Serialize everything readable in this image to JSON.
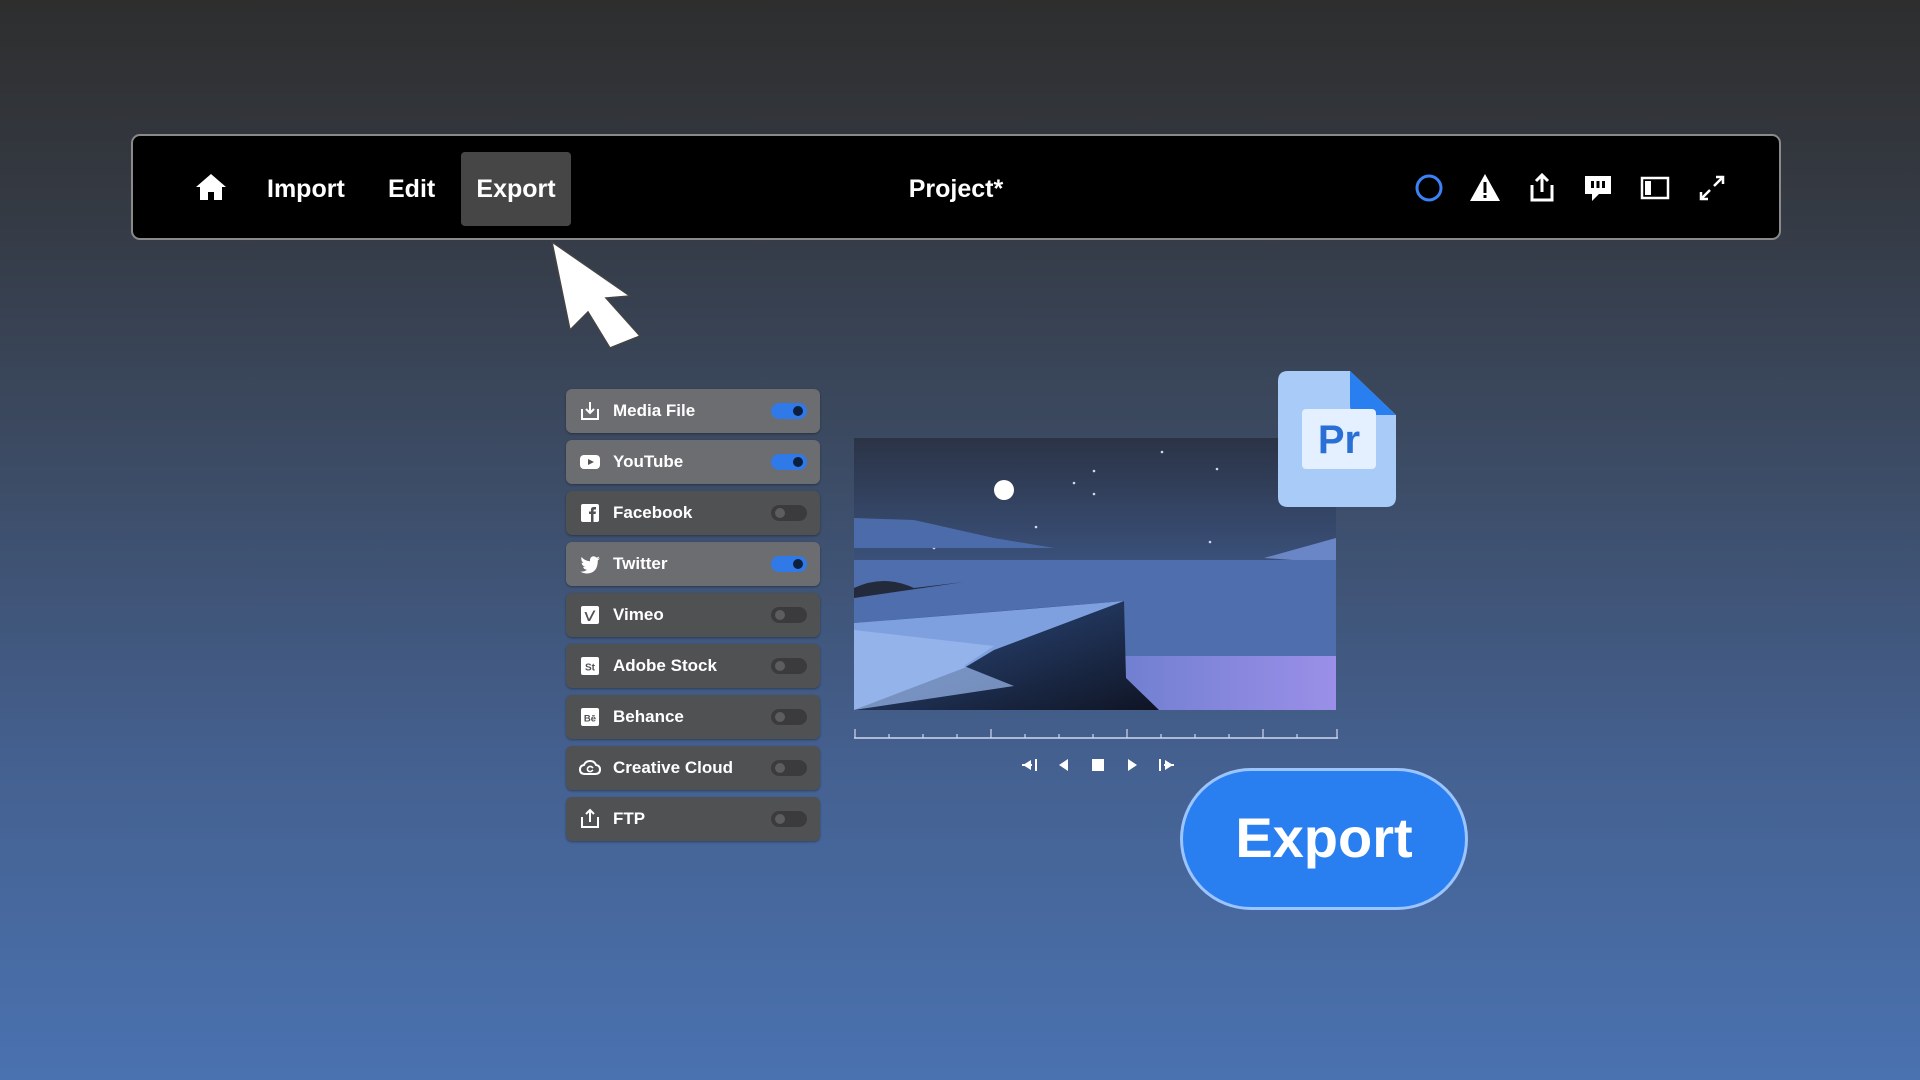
{
  "nav": {
    "home_icon": "home-icon",
    "import_label": "Import",
    "edit_label": "Edit",
    "export_label": "Export",
    "project_title": "Project*"
  },
  "toolbar_icons": [
    "progress-ring-icon",
    "warning-icon",
    "share-icon",
    "feedback-icon",
    "panel-layout-icon",
    "fullscreen-icon"
  ],
  "destinations": [
    {
      "label": "Media File",
      "icon": "download-icon",
      "enabled": true
    },
    {
      "label": "YouTube",
      "icon": "youtube-icon",
      "enabled": true
    },
    {
      "label": "Facebook",
      "icon": "facebook-icon",
      "enabled": false
    },
    {
      "label": "Twitter",
      "icon": "twitter-icon",
      "enabled": true
    },
    {
      "label": "Vimeo",
      "icon": "vimeo-icon",
      "enabled": false
    },
    {
      "label": "Adobe Stock",
      "icon": "adobe-stock-icon",
      "enabled": false
    },
    {
      "label": "Behance",
      "icon": "behance-icon",
      "enabled": false
    },
    {
      "label": "Creative Cloud",
      "icon": "creative-cloud-icon",
      "enabled": false
    },
    {
      "label": "FTP",
      "icon": "upload-icon",
      "enabled": false
    }
  ],
  "transport": [
    "go-to-start-icon",
    "step-back-icon",
    "stop-icon",
    "play-icon",
    "go-to-end-icon"
  ],
  "pr_badge": "Pr",
  "export_button": "Export",
  "colors": {
    "accent": "#2a7ff0",
    "toggle_on": "#2f79e8",
    "pr_file": "#a9cbf7",
    "pr_text": "#2a6fd6"
  }
}
